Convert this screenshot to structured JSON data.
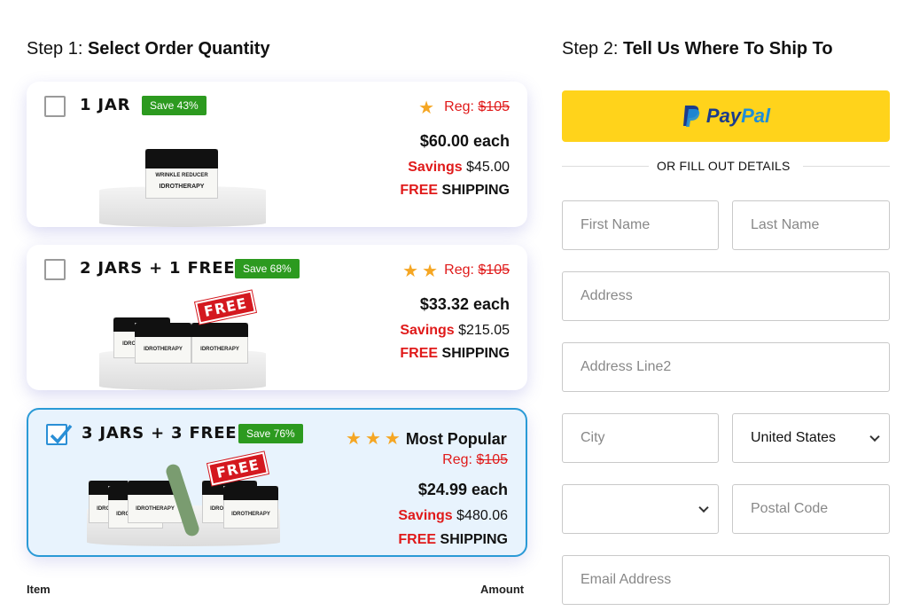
{
  "step1": {
    "prefix": "Step 1:",
    "title": "Select Order Quantity"
  },
  "step2": {
    "prefix": "Step 2:",
    "title": "Tell Us Where To Ship To"
  },
  "packages": [
    {
      "title": "1 JAR",
      "badge": "Save 43%",
      "stars": 1,
      "reg_label": "Reg:",
      "reg_price": "$105",
      "each": "$60.00 each",
      "savings_label": "Savings",
      "savings_value": "$45.00",
      "free_label": "FREE",
      "shipping_label": "SHIPPING",
      "selected": false
    },
    {
      "title": "2 JARS + 1 FREE",
      "badge": "Save 68%",
      "stars": 2,
      "reg_label": "Reg:",
      "reg_price": "$105",
      "each": "$33.32 each",
      "savings_label": "Savings",
      "savings_value": "$215.05",
      "free_label": "FREE",
      "shipping_label": "SHIPPING",
      "free_stamp": "FREE",
      "selected": false
    },
    {
      "title": "3 JARS + 3 FREE",
      "badge": "Save 76%",
      "stars": 3,
      "popular": "Most Popular",
      "reg_label": "Reg:",
      "reg_price": "$105",
      "each": "$24.99 each",
      "savings_label": "Savings",
      "savings_value": "$480.06",
      "free_label": "FREE",
      "shipping_label": "SHIPPING",
      "free_stamp": "FREE",
      "selected": true
    }
  ],
  "jar_label": {
    "line1": "WRINKLE REDUCER",
    "brand": "IDROTHERAPY"
  },
  "summary": {
    "item": "Item",
    "amount": "Amount"
  },
  "paypal": {
    "pay": "Pay",
    "pal": "Pal"
  },
  "or_divider": "OR FILL OUT DETAILS",
  "form": {
    "first_name": "First Name",
    "last_name": "Last Name",
    "address": "Address",
    "address2": "Address Line2",
    "city": "City",
    "country": "United States",
    "state": "",
    "postal": "Postal Code",
    "email": "Email Address"
  },
  "colors": {
    "accent_red": "#e01a1a",
    "badge_green": "#2c9a1f",
    "paypal_yellow": "#ffd31b",
    "selected_border": "#2a9ad6",
    "star": "#f5a623"
  }
}
